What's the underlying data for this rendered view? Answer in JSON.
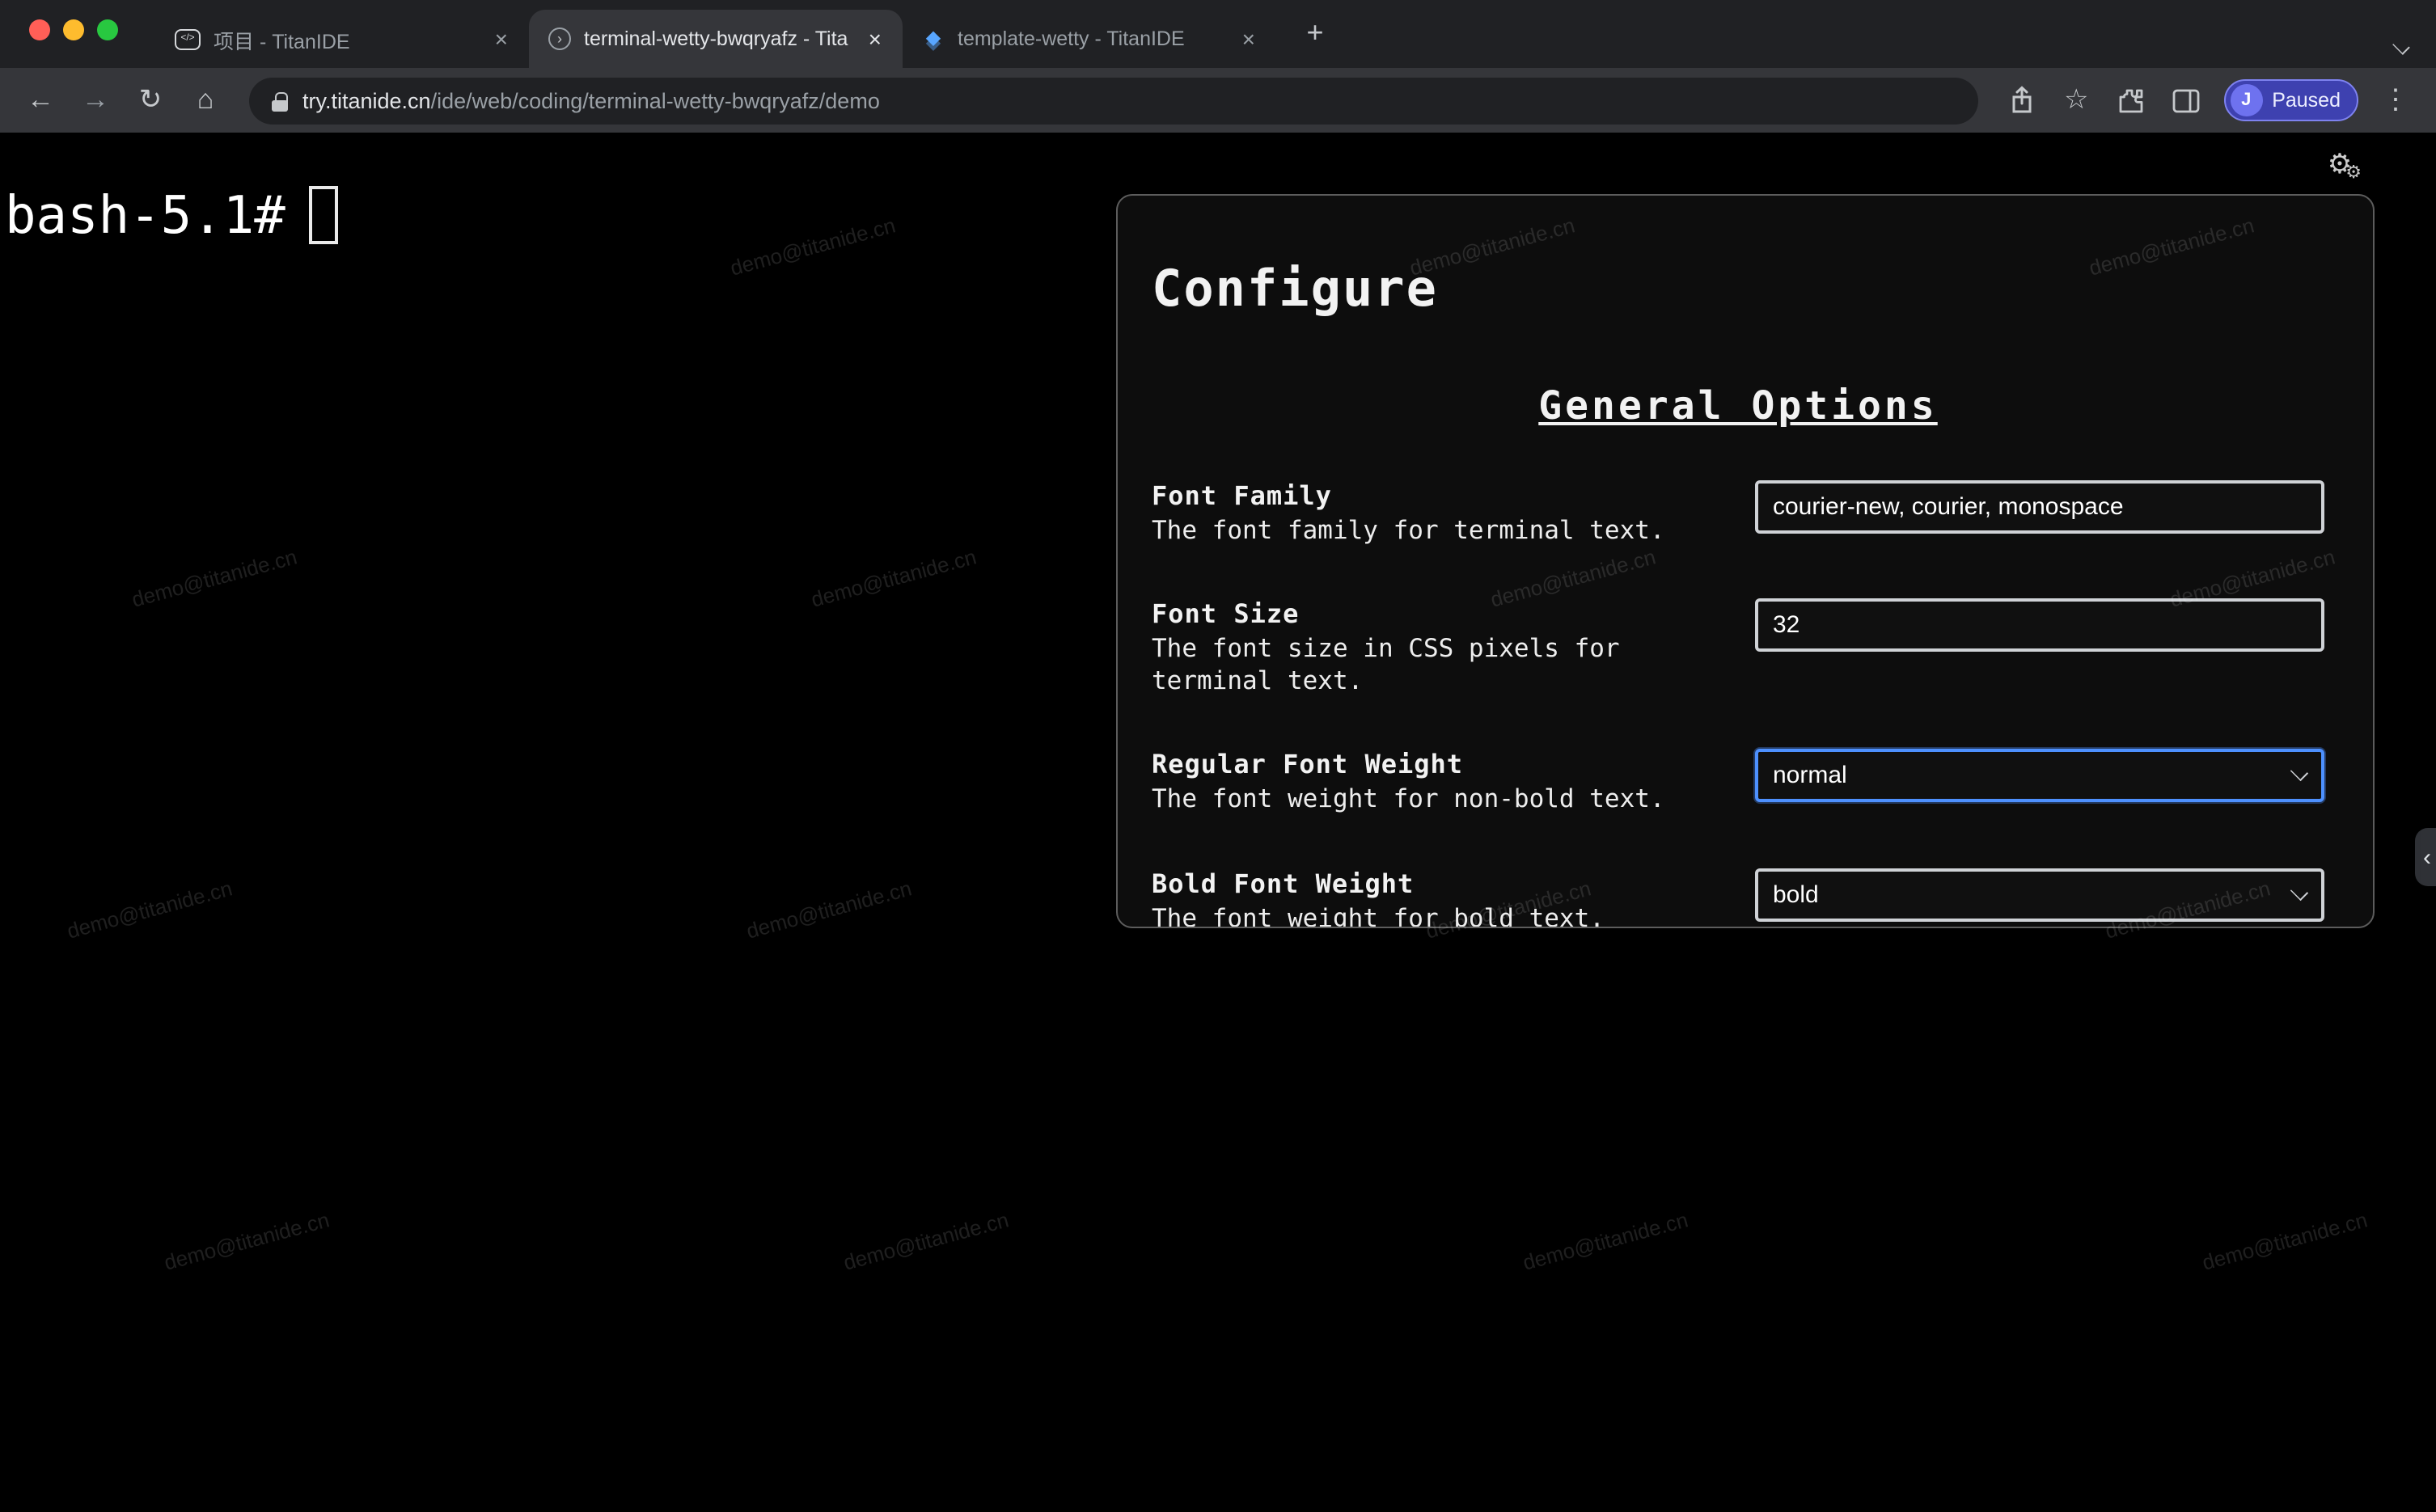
{
  "browser": {
    "tabs": [
      {
        "title": "项目 - TitanIDE",
        "icon": "code-badge-icon",
        "active": false
      },
      {
        "title": "terminal-wetty-bwqryafz - Tita",
        "icon": "terminal-circle-icon",
        "active": true
      },
      {
        "title": "template-wetty - TitanIDE",
        "icon": "layers-icon",
        "active": false
      }
    ],
    "url_host": "try.titanide.cn",
    "url_path": "/ide/web/coding/terminal-wetty-bwqryafz/demo",
    "profile": {
      "initial": "J",
      "status": "Paused"
    }
  },
  "terminal": {
    "prompt": "bash-5.1#",
    "watermark": "demo@titanide.cn"
  },
  "panel": {
    "title": "Configure",
    "section_title": "General Options",
    "fields": [
      {
        "label": "Font Family",
        "description": "The font family for terminal text.",
        "control": "input",
        "value": "courier-new, courier, monospace"
      },
      {
        "label": "Font Size",
        "description": "The font size in CSS pixels for terminal text.",
        "control": "input",
        "value": "32"
      },
      {
        "label": "Regular Font Weight",
        "description": "The font weight for non-bold text.",
        "control": "select",
        "value": "normal"
      },
      {
        "label": "Bold Font Weight",
        "description": "The font weight for bold text.",
        "control": "select",
        "value": "bold"
      }
    ]
  },
  "colors": {
    "accent_focus": "#4d90fe",
    "paused_badge": "#3e41b0"
  }
}
